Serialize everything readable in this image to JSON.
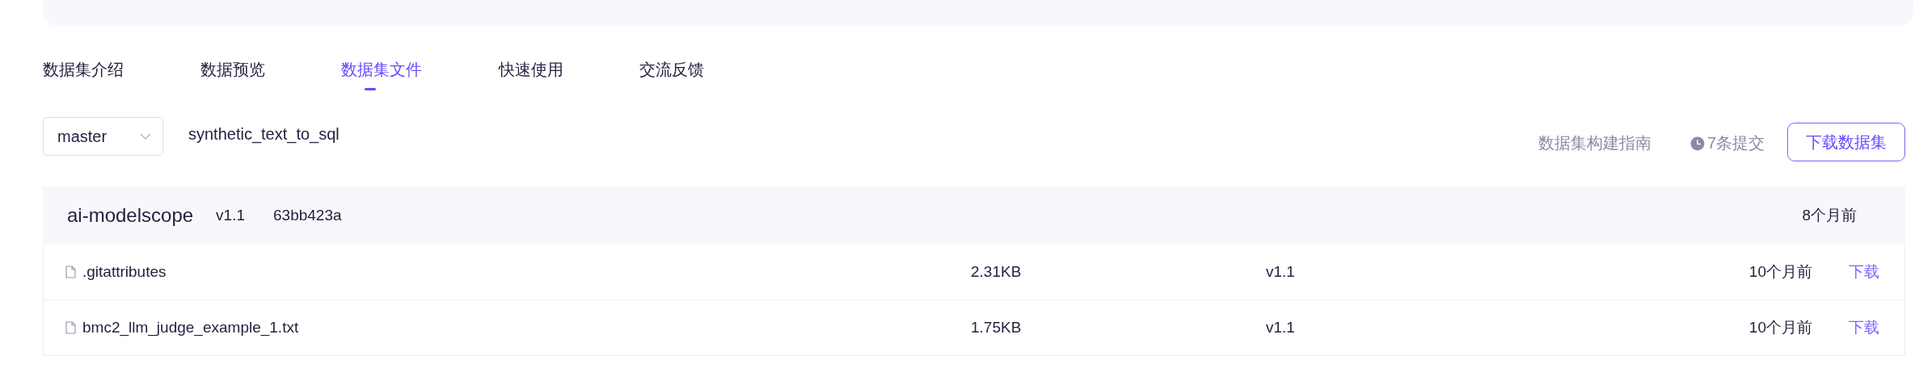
{
  "tabs": [
    {
      "label": "数据集介绍",
      "selected": false
    },
    {
      "label": "数据预览",
      "selected": false
    },
    {
      "label": "数据集文件",
      "selected": true
    },
    {
      "label": "快速使用",
      "selected": false
    },
    {
      "label": "交流反馈",
      "selected": false
    }
  ],
  "toolbar": {
    "branch": "master",
    "dataset_name": "synthetic_text_to_sql",
    "guide_link": "数据集构建指南",
    "commits": "7条提交",
    "download_button": "下载数据集"
  },
  "file_table": {
    "header": {
      "author": "ai-modelscope",
      "version": "v1.1",
      "commit": "63bb423a",
      "time": "8个月前"
    },
    "rows": [
      {
        "name": ".gitattributes",
        "size": "2.31KB",
        "version": "v1.1",
        "time": "10个月前",
        "action": "下载"
      },
      {
        "name": "bmc2_llm_judge_example_1.txt",
        "size": "1.75KB",
        "version": "v1.1",
        "time": "10个月前",
        "action": "下载"
      }
    ]
  }
}
